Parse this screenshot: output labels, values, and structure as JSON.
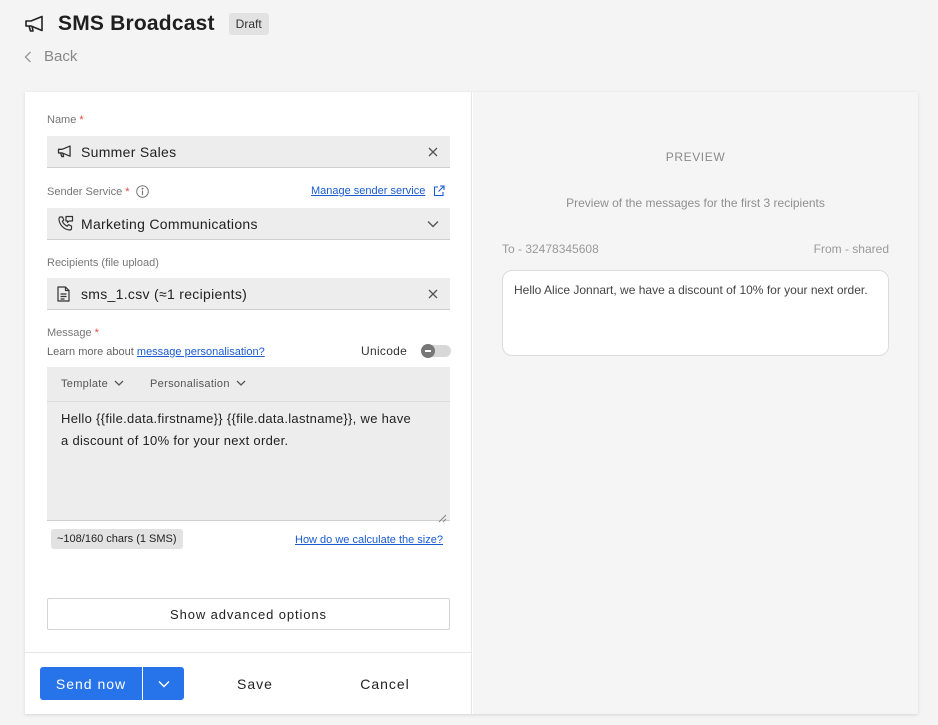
{
  "header": {
    "title": "SMS Broadcast",
    "badge": "Draft",
    "back_label": "Back",
    "icon": "megaphone-icon"
  },
  "form": {
    "name": {
      "label": "Name",
      "required_mark": "*",
      "value": "Summer Sales",
      "icon": "megaphone-icon"
    },
    "sender_service": {
      "label": "Sender Service",
      "required_mark": "*",
      "manage_link": "Manage sender service",
      "value": "Marketing Communications",
      "icon": "phone-chat-icon"
    },
    "recipients": {
      "label": "Recipients (file upload)",
      "value": "sms_1.csv (≈1 recipients)",
      "icon": "file-icon"
    },
    "message": {
      "label": "Message",
      "required_mark": "*",
      "learn_prefix": "Learn more about",
      "learn_link": "message personalisation?",
      "unicode_label": "Unicode",
      "unicode_enabled": false,
      "toolbar": {
        "template_label": "Template",
        "personalisation_label": "Personalisation"
      },
      "body_lines": [
        "Hello {{file.data.firstname}} {{file.data.lastname}}, we have",
        "a discount of 10% for your next order."
      ],
      "char_count": "~108/160 chars (1 SMS)",
      "calc_link": "How do we calculate the size?"
    },
    "advanced_label": "Show advanced options"
  },
  "footer": {
    "send_label": "Send now",
    "save_label": "Save",
    "cancel_label": "Cancel"
  },
  "preview": {
    "title": "PREVIEW",
    "subtitle": "Preview of the messages for the first 3 recipients",
    "to": "To - 32478345608",
    "from": "From - shared",
    "message": "Hello Alice Jonnart, we have a discount of 10% for your next order."
  },
  "colors": {
    "primary": "#2673ea",
    "link": "#1a5bd1",
    "required": "#e04a3f",
    "field_bg": "#ededed"
  }
}
